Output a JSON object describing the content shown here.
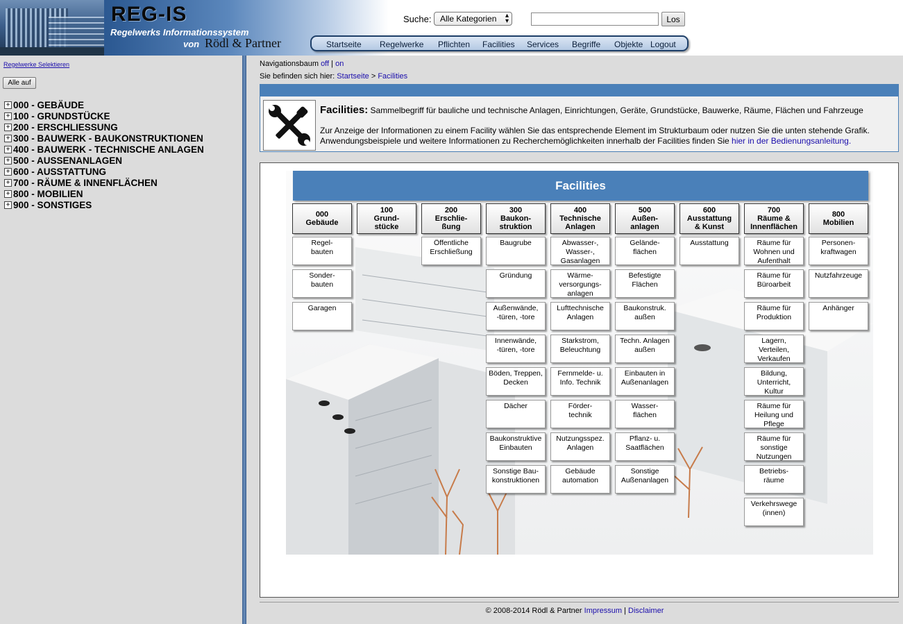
{
  "header": {
    "logo_title": "REG-IS",
    "logo_subtitle": "Regelwerks Informationssystem",
    "logo_von": "von",
    "logo_company": "Rödl & Partner",
    "search_label": "Suche:",
    "category_selected": "Alle Kategorien",
    "search_value": "",
    "go_label": "Los",
    "nav": [
      "Startseite",
      "Regelwerke",
      "Pflichten",
      "Facilities",
      "Services",
      "Begriffe",
      "Objekte",
      "Logout"
    ]
  },
  "sidebar": {
    "select_link": "Regelwerke Selektieren",
    "expand_all": "Alle auf",
    "expand_icon": "+",
    "tree": [
      "000 - GEBÄUDE",
      "100 - GRUNDSTÜCKE",
      "200 - ERSCHLIESSUNG",
      "300 - BAUWERK - BAUKONSTRUKTIONEN",
      "400 - BAUWERK - TECHNISCHE ANLAGEN",
      "500 - AUSSENANLAGEN",
      "600 - AUSSTATTUNG",
      "700 - RÄUME & INNENFLÄCHEN",
      "800 - MOBILIEN",
      "900 - SONSTIGES"
    ]
  },
  "content": {
    "navtree_label": "Navigationsbaum",
    "navtree_off": "off",
    "navtree_sep": "|",
    "navtree_on": "on",
    "breadcrumb_prefix": "Sie befinden sich hier:",
    "breadcrumb_home": "Startseite",
    "breadcrumb_sep": ">",
    "breadcrumb_current": "Facilities",
    "info_title": "Facilities:",
    "info_desc": "Sammelbegriff für bauliche und technische Anlagen, Einrichtungen, Geräte, Grundstücke, Bauwerke, Räume, Flächen und Fahrzeuge",
    "info_text1": "Zur Anzeige der Informationen zu einem Facility wählen Sie das entsprechende Element im Strukturbaum oder nutzen Sie die unten stehende Grafik.",
    "info_text2": "Anwendungsbeispiele und weitere Informationen zu Recherchemöglichkeiten innerhalb der Facilities finden Sie",
    "info_link": "hier in der Bedienungsanleitung.",
    "graphic_title": "Facilities",
    "columns": [
      {
        "code": "000",
        "name": "Gebäude",
        "items": [
          "Regel-\nbauten",
          "Sonder-\nbauten",
          "Garagen"
        ]
      },
      {
        "code": "100",
        "name": "Grund-\nstücke",
        "items": []
      },
      {
        "code": "200",
        "name": "Erschlie-\nßung",
        "items": [
          "Öffentliche\nErschließung"
        ]
      },
      {
        "code": "300",
        "name": "Baukon-\nstruktion",
        "items": [
          "Baugrube",
          "Gründung",
          "Außenwände,\n-türen, -tore",
          "Innenwände,\n-türen, -tore",
          "Böden, Treppen,\nDecken",
          "Dächer",
          "Baukonstruktive\nEinbauten",
          "Sonstige Bau-\nkonstruktionen"
        ]
      },
      {
        "code": "400",
        "name": "Technische\nAnlagen",
        "items": [
          "Abwasser-,\nWasser-,\nGasanlagen",
          "Wärme-\nversorgungs-\nanlagen",
          "Lufttechnische\nAnlagen",
          "Starkstrom,\nBeleuchtung",
          "Fernmelde- u.\nInfo. Technik",
          "Förder-\ntechnik",
          "Nutzungsspez.\nAnlagen",
          "Gebäude\nautomation"
        ]
      },
      {
        "code": "500",
        "name": "Außen-\nanlagen",
        "items": [
          "Gelände-\nflächen",
          "Befestigte\nFlächen",
          "Baukonstruk.\naußen",
          "Techn. Anlagen\naußen",
          "Einbauten in\nAußenanlagen",
          "Wasser-\nflächen",
          "Pflanz- u.\nSaatflächen",
          "Sonstige\nAußenanlagen"
        ]
      },
      {
        "code": "600",
        "name": "Ausstattung\n& Kunst",
        "items": [
          "Ausstattung"
        ]
      },
      {
        "code": "700",
        "name": "Räume &\nInnenflächen",
        "items": [
          "Räume für\nWohnen und\nAufenthalt",
          "Räume für\nBüroarbeit",
          "Räume für\nProduktion",
          "Lagern,\nVerteilen,\nVerkaufen",
          "Bildung,\nUnterricht,\nKultur",
          "Räume für\nHeilung und\nPflege",
          "Räume für\nsonstige\nNutzungen",
          "Betriebs-\nräume",
          "Verkehrswege\n(innen)"
        ]
      },
      {
        "code": "800",
        "name": "Mobilien",
        "items": [
          "Personen-\nkraftwagen",
          "Nutzfahrzeuge",
          "Anhänger"
        ]
      }
    ]
  },
  "footer": {
    "copyright": "© 2008-2014 Rödl & Partner",
    "impressum": "Impressum",
    "sep": "|",
    "disclaimer": "Disclaimer"
  },
  "colors": {
    "header_blue": "#2d5a93",
    "bar_blue": "#4a80b9",
    "sidebar_bg": "#dcdcdc",
    "link": "#1a0dab"
  }
}
